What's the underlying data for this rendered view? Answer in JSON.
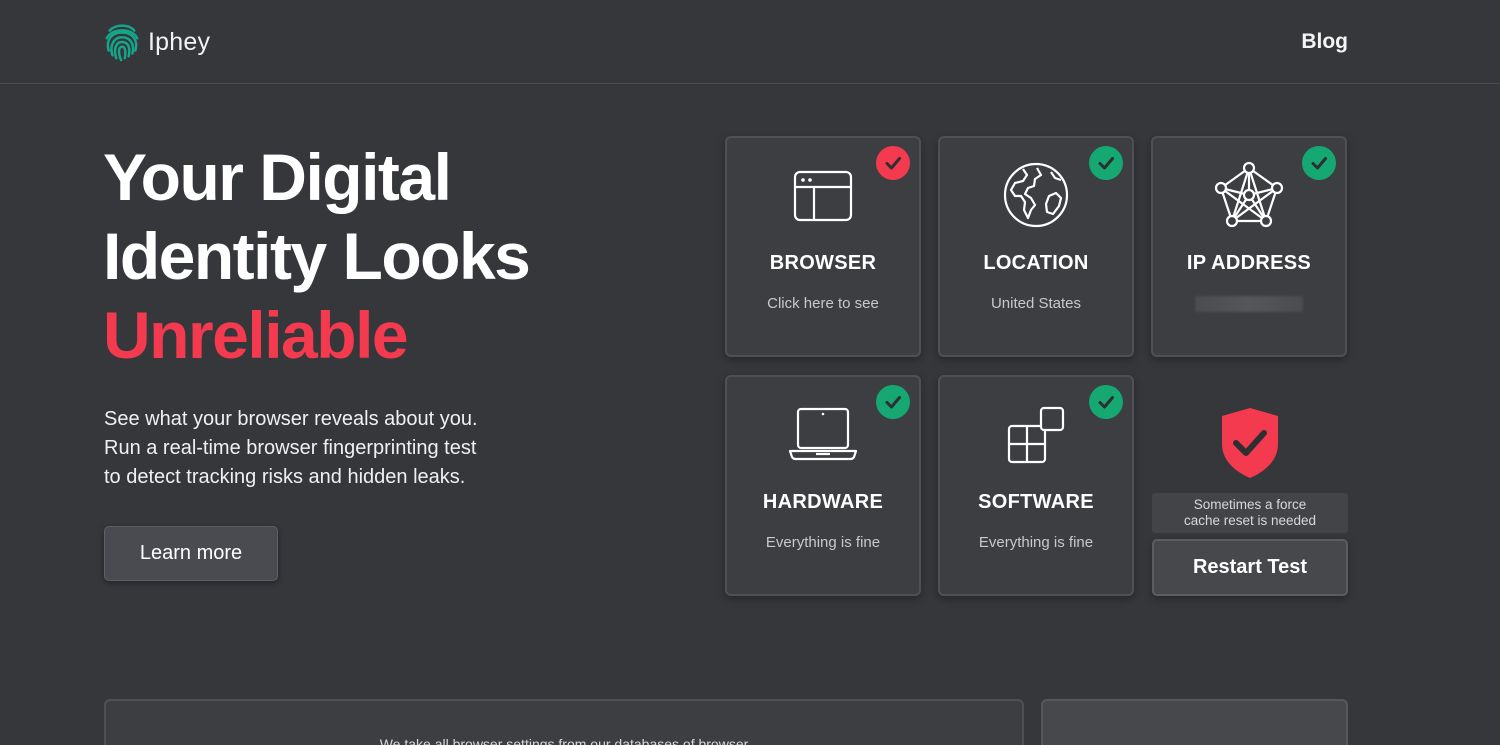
{
  "header": {
    "logo_text": "Iphey",
    "blog_label": "Blog"
  },
  "hero": {
    "title_line1": "Your Digital",
    "title_line2": "Identity Looks",
    "title_accent": "Unreliable",
    "desc_line1": "See what your browser reveals about you.",
    "desc_line2": "Run a real-time browser fingerprinting test",
    "desc_line3": "to detect tracking risks and hidden leaks.",
    "learn_more_label": "Learn more"
  },
  "cards": [
    {
      "title": "BROWSER",
      "subtitle": "Click here to see",
      "status": "bad",
      "icon": "browser-window-icon"
    },
    {
      "title": "LOCATION",
      "subtitle": "United States",
      "status": "ok",
      "icon": "globe-icon"
    },
    {
      "title": "IP ADDRESS",
      "subtitle": "",
      "status": "ok",
      "icon": "network-icon"
    },
    {
      "title": "HARDWARE",
      "subtitle": "Everything is fine",
      "status": "ok",
      "icon": "laptop-icon"
    },
    {
      "title": "SOFTWARE",
      "subtitle": "Everything is fine",
      "status": "ok",
      "icon": "apps-icon"
    }
  ],
  "reset": {
    "note_line1": "Sometimes a force",
    "note_line2": "cache reset is needed",
    "restart_label": "Restart Test"
  },
  "bottom": {
    "text": "We take all browser settings from our databases of browser"
  },
  "colors": {
    "background": "#36373b",
    "accent_red": "#f33a4f",
    "ok_green": "#15a872",
    "logo_green": "#14a58b"
  }
}
